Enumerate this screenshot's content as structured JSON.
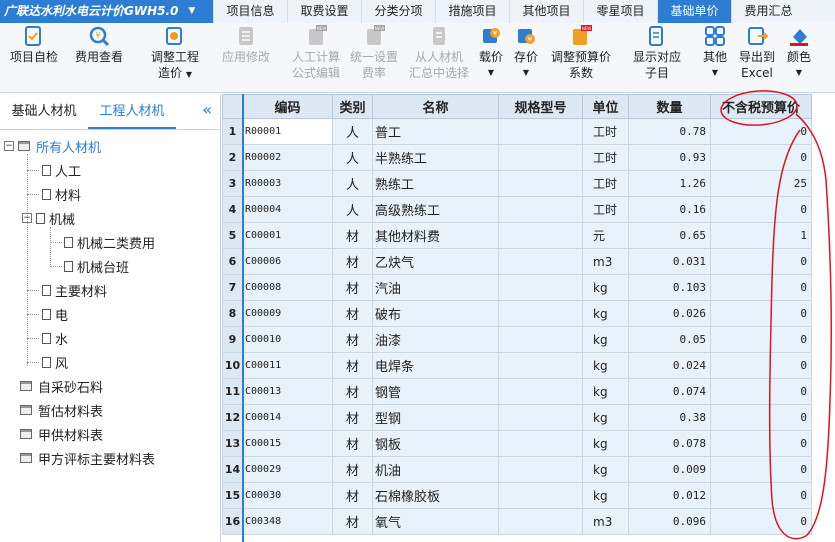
{
  "app": {
    "title": "广联达水利水电云计价GWH5.0"
  },
  "menu": {
    "tabs": [
      "项目信息",
      "取费设置",
      "分类分项",
      "措施项目",
      "其他项目",
      "零星项目",
      "基础单价",
      "费用汇总"
    ],
    "active": "基础单价"
  },
  "toolbar": {
    "buttons": [
      {
        "line1": "项目自检",
        "line2": ""
      },
      {
        "line1": "费用查看",
        "line2": ""
      },
      {
        "line1": "调整工程",
        "line2": "造价"
      },
      {
        "line1": "应用修改",
        "line2": ""
      },
      {
        "line1": "人工计算",
        "line2": "公式编辑"
      },
      {
        "line1": "统一设置",
        "line2": "费率"
      },
      {
        "line1": "从人材机",
        "line2": "汇总中选择"
      },
      {
        "line1": "载价",
        "line2": ""
      },
      {
        "line1": "存价",
        "line2": ""
      },
      {
        "line1": "调整预算价",
        "line2": "系数"
      },
      {
        "line1": "显示对应",
        "line2": "子目"
      },
      {
        "line1": "其他",
        "line2": ""
      },
      {
        "line1": "导出到",
        "line2": "Excel"
      },
      {
        "line1": "颜色",
        "line2": ""
      }
    ],
    "badge": "NEW"
  },
  "left_panel": {
    "tabs": [
      "基础人材机",
      "工程人材机"
    ],
    "active_tab": "工程人材机",
    "collapse_glyph": "«",
    "tree": [
      {
        "label": "所有人材机",
        "level": 0
      },
      {
        "label": "人工",
        "level": 1
      },
      {
        "label": "材料",
        "level": 1
      },
      {
        "label": "机械",
        "level": 1
      },
      {
        "label": "机械二类费用",
        "level": 2
      },
      {
        "label": "机械台班",
        "level": 2
      },
      {
        "label": "主要材料",
        "level": 1
      },
      {
        "label": "电",
        "level": 1
      },
      {
        "label": "水",
        "level": 1
      },
      {
        "label": "风",
        "level": 1
      },
      {
        "label": "自采砂石料",
        "level": 0
      },
      {
        "label": "暂估材料表",
        "level": 0
      },
      {
        "label": "甲供材料表",
        "level": 0
      },
      {
        "label": "甲方评标主要材料表",
        "level": 0
      }
    ]
  },
  "grid": {
    "columns": [
      "",
      "编码",
      "类别",
      "名称",
      "规格型号",
      "单位",
      "数量",
      "不含税预算价"
    ],
    "rows": [
      {
        "n": "1",
        "code": "R00001",
        "cat": "人",
        "name": "普工",
        "spec": "",
        "unit": "工时",
        "qty": "0.78",
        "price": "0"
      },
      {
        "n": "2",
        "code": "R00002",
        "cat": "人",
        "name": "半熟练工",
        "spec": "",
        "unit": "工时",
        "qty": "0.93",
        "price": "0"
      },
      {
        "n": "3",
        "code": "R00003",
        "cat": "人",
        "name": "熟练工",
        "spec": "",
        "unit": "工时",
        "qty": "1.26",
        "price": "25"
      },
      {
        "n": "4",
        "code": "R00004",
        "cat": "人",
        "name": "高级熟练工",
        "spec": "",
        "unit": "工时",
        "qty": "0.16",
        "price": "0"
      },
      {
        "n": "5",
        "code": "C00001",
        "cat": "材",
        "name": "其他材料费",
        "spec": "",
        "unit": "元",
        "qty": "0.65",
        "price": "1"
      },
      {
        "n": "6",
        "code": "C00006",
        "cat": "材",
        "name": "乙炔气",
        "spec": "",
        "unit": "m3",
        "qty": "0.031",
        "price": "0"
      },
      {
        "n": "7",
        "code": "C00008",
        "cat": "材",
        "name": "汽油",
        "spec": "",
        "unit": "kg",
        "qty": "0.103",
        "price": "0"
      },
      {
        "n": "8",
        "code": "C00009",
        "cat": "材",
        "name": "破布",
        "spec": "",
        "unit": "kg",
        "qty": "0.026",
        "price": "0"
      },
      {
        "n": "9",
        "code": "C00010",
        "cat": "材",
        "name": "油漆",
        "spec": "",
        "unit": "kg",
        "qty": "0.05",
        "price": "0"
      },
      {
        "n": "10",
        "code": "C00011",
        "cat": "材",
        "name": "电焊条",
        "spec": "",
        "unit": "kg",
        "qty": "0.024",
        "price": "0"
      },
      {
        "n": "11",
        "code": "C00013",
        "cat": "材",
        "name": "钢管",
        "spec": "",
        "unit": "kg",
        "qty": "0.074",
        "price": "0"
      },
      {
        "n": "12",
        "code": "C00014",
        "cat": "材",
        "name": "型钢",
        "spec": "",
        "unit": "kg",
        "qty": "0.38",
        "price": "0"
      },
      {
        "n": "13",
        "code": "C00015",
        "cat": "材",
        "name": "钢板",
        "spec": "",
        "unit": "kg",
        "qty": "0.078",
        "price": "0"
      },
      {
        "n": "14",
        "code": "C00029",
        "cat": "材",
        "name": "机油",
        "spec": "",
        "unit": "kg",
        "qty": "0.009",
        "price": "0"
      },
      {
        "n": "15",
        "code": "C00030",
        "cat": "材",
        "name": "石棉橡胶板",
        "spec": "",
        "unit": "kg",
        "qty": "0.012",
        "price": "0"
      },
      {
        "n": "16",
        "code": "C00348",
        "cat": "材",
        "name": "氧气",
        "spec": "",
        "unit": "m3",
        "qty": "0.096",
        "price": "0"
      }
    ]
  },
  "colors": {
    "accent": "#2c7dd3",
    "annotation": "#e0141e"
  }
}
